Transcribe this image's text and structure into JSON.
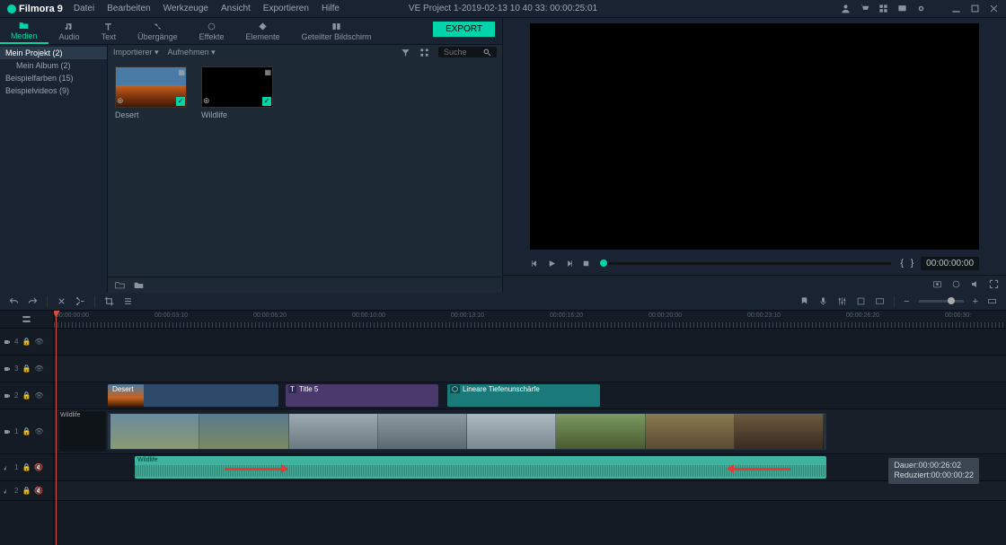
{
  "app": {
    "name": "Filmora",
    "version": "9"
  },
  "title": "VE Project 1-2019-02-13 10 40 33: 00:00:25:01",
  "menu": [
    "Datei",
    "Bearbeiten",
    "Werkzeuge",
    "Ansicht",
    "Exportieren",
    "Hilfe"
  ],
  "tabs": [
    {
      "id": "medien",
      "label": "Medien"
    },
    {
      "id": "audio",
      "label": "Audio"
    },
    {
      "id": "text",
      "label": "Text"
    },
    {
      "id": "ubergange",
      "label": "Übergänge"
    },
    {
      "id": "effekte",
      "label": "Effekte"
    },
    {
      "id": "elemente",
      "label": "Elemente"
    },
    {
      "id": "geteilter",
      "label": "Geteilter Bildschirm"
    }
  ],
  "export_label": "EXPORT",
  "tree": [
    {
      "label": "Mein Projekt (2)",
      "sel": true,
      "child": false
    },
    {
      "label": "Mein Album (2)",
      "sel": false,
      "child": true
    },
    {
      "label": "Beispielfarben (15)",
      "sel": false,
      "child": false
    },
    {
      "label": "Beispielvideos (9)",
      "sel": false,
      "child": false
    }
  ],
  "browser_bar": {
    "import": "Importierer",
    "record": "Aufnehmen"
  },
  "search": {
    "placeholder": "Suche"
  },
  "thumbs": [
    {
      "name": "Desert",
      "kind": "desert"
    },
    {
      "name": "Wildlife",
      "kind": "black"
    }
  ],
  "timecode_right": "00:00:00:00",
  "ruler": [
    "00:00:00:00",
    "00:00:03:10",
    "00:00:06:20",
    "00:00:10:00",
    "00:00:13:10",
    "00:00:16:20",
    "00:00:20:00",
    "00:00:23:10",
    "00:00:26:20",
    "00:00:30:"
  ],
  "tracks": {
    "v4": "4",
    "v3": "3",
    "v2": "2",
    "v1": "1",
    "a1": "1",
    "a2": "2"
  },
  "clips": {
    "desert": "Desert",
    "title": "Title 5",
    "effect": "Lineare Tiefenunschärfe",
    "wildlife": "Wildlife",
    "audio": "Wildlife"
  },
  "tooltip": {
    "dauer_l": "Dauer:",
    "dauer_v": "00:00:26:02",
    "red_l": "Reduziert:",
    "red_v": "00:00:00:22"
  }
}
